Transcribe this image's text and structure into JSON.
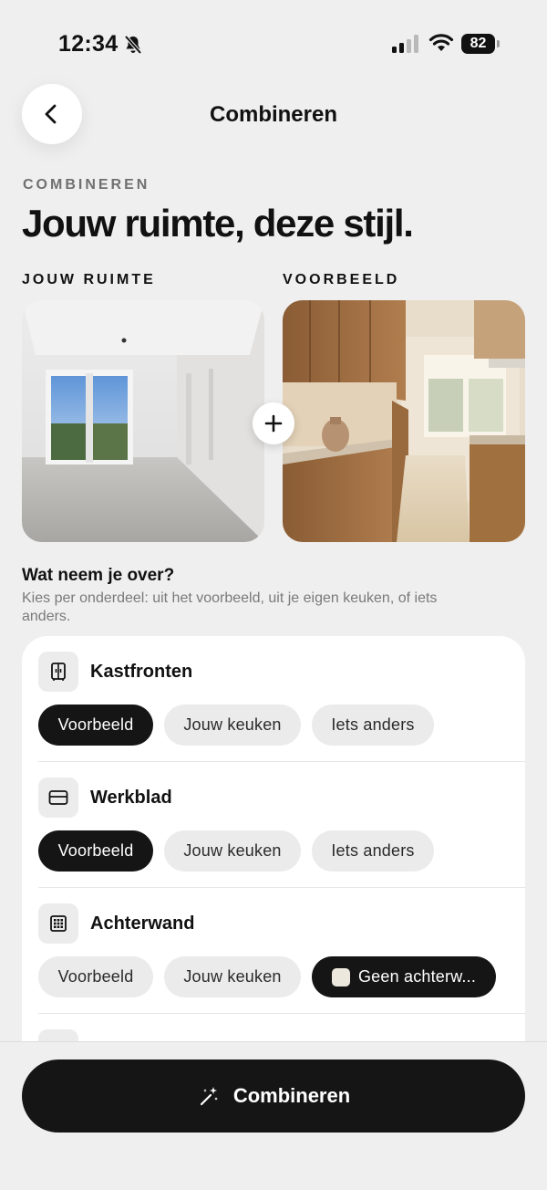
{
  "status": {
    "time": "12:34",
    "battery": "82"
  },
  "nav": {
    "title": "Combineren"
  },
  "header": {
    "eyebrow": "COMBINEREN",
    "headline": "Jouw ruimte, deze stijl."
  },
  "images": {
    "left_label": "JOUW RUIMTE",
    "right_label": "VOORBEELD"
  },
  "section": {
    "title": "Wat neem je over?",
    "subtitle": "Kies per onderdeel: uit het voorbeeld, uit je eigen keuken, of iets anders."
  },
  "items": [
    {
      "name": "Kastfronten",
      "icon": "cabinet-icon",
      "options": [
        "Voorbeeld",
        "Jouw keuken",
        "Iets anders"
      ],
      "selected": "Voorbeeld"
    },
    {
      "name": "Werkblad",
      "icon": "countertop-icon",
      "options": [
        "Voorbeeld",
        "Jouw keuken",
        "Iets anders"
      ],
      "selected": "Voorbeeld"
    },
    {
      "name": "Achterwand",
      "icon": "tiles-icon",
      "options": [
        "Voorbeeld",
        "Jouw keuken",
        "Geen achterw..."
      ],
      "selected": "Geen achterw..."
    }
  ],
  "cta": {
    "label": "Combineren",
    "icon": "magic-wand-icon"
  },
  "colors": {
    "background": "#efefef",
    "selected_chip": "#151515",
    "chip": "#ebebeb"
  }
}
